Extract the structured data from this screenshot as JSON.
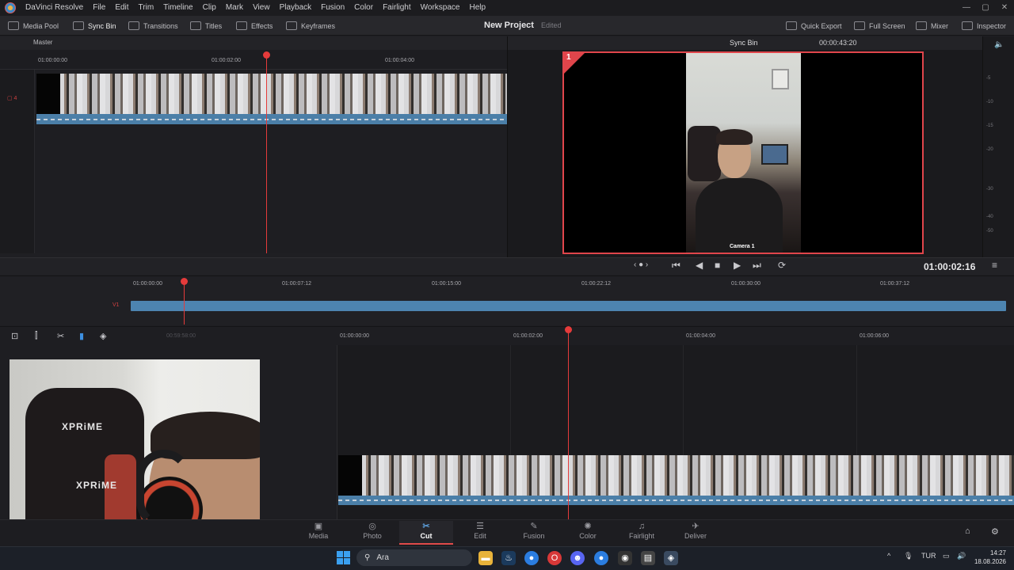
{
  "app": {
    "title": "DaVinci Resolve",
    "menu": [
      "File",
      "Edit",
      "Trim",
      "Timeline",
      "Clip",
      "Mark",
      "View",
      "Playback",
      "Fusion",
      "Color",
      "Fairlight",
      "Workspace",
      "Help"
    ]
  },
  "toolbar": {
    "media_pool": "Media Pool",
    "sync_bin": "Sync Bin",
    "transitions": "Transitions",
    "titles": "Titles",
    "effects": "Effects",
    "keyframes": "Keyframes",
    "quick_export": "Quick Export",
    "full_screen": "Full Screen",
    "mixer": "Mixer",
    "inspector": "Inspector"
  },
  "project": {
    "name": "New Project",
    "status": "Edited"
  },
  "source": {
    "bin_label": "Master",
    "ruler": [
      "01:00:00:00",
      "01:00:02:00",
      "01:00:04:00"
    ]
  },
  "viewer": {
    "title": "Sync Bin",
    "timecode_top": "00:00:43:20",
    "camera_number": "1",
    "camera_label": "Camera 1",
    "timecode": "01:00:02:16"
  },
  "meter": {
    "ticks": [
      "-5",
      "-10",
      "-15",
      "-20",
      "-30",
      "-40",
      "-50"
    ]
  },
  "upper_timeline": {
    "ruler": [
      "01:00:00:00",
      "01:00:07:12",
      "01:00:15:00",
      "01:00:22:12",
      "01:00:30:00",
      "01:00:37:12"
    ]
  },
  "lower_timeline": {
    "pre_ruler": "00:59:58:00",
    "ruler": [
      "01:00:00:00",
      "01:00:02:00",
      "01:00:04:00",
      "01:00:06:00"
    ]
  },
  "pages": [
    {
      "label": "Media",
      "glyph": "▣"
    },
    {
      "label": "Photo",
      "glyph": "◎"
    },
    {
      "label": "Cut",
      "glyph": "✂"
    },
    {
      "label": "Edit",
      "glyph": "☰"
    },
    {
      "label": "Fusion",
      "glyph": "✎"
    },
    {
      "label": "Color",
      "glyph": "✺"
    },
    {
      "label": "Fairlight",
      "glyph": "♫"
    },
    {
      "label": "Deliver",
      "glyph": "✈"
    }
  ],
  "taskbar": {
    "search_placeholder": "Ara",
    "language": "TUR",
    "time": "14:27",
    "date": "18.08.2026"
  },
  "webcam": {
    "logo_top": "XPRiME",
    "logo_bottom": "XPRiME"
  }
}
